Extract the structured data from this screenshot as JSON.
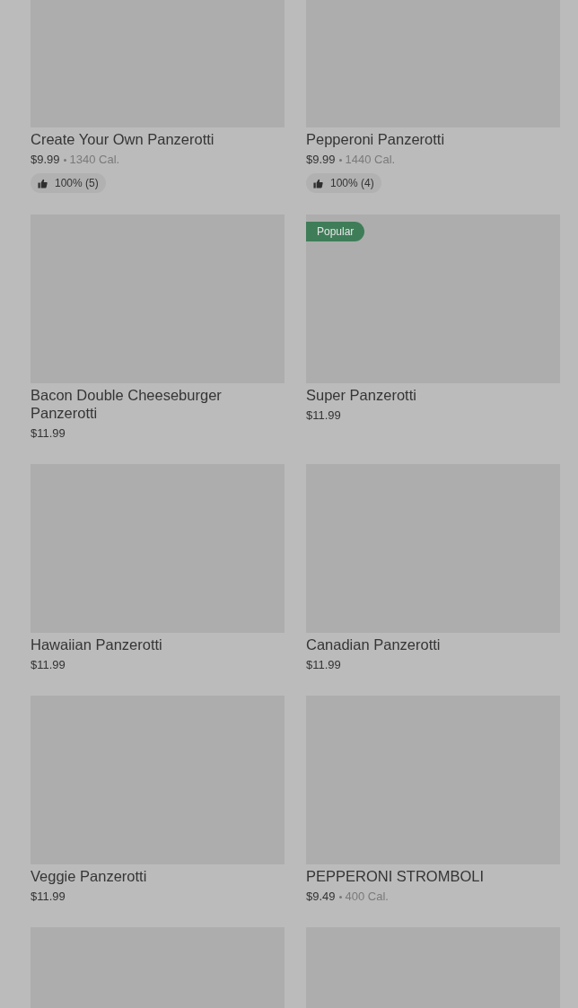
{
  "menu_rows": [
    {
      "items": [
        {
          "kind": "full",
          "name": "Create Your Own Panzerotti",
          "price": "$9.99",
          "calories": "1340 Cal.",
          "rating": "100% (5)"
        },
        {
          "kind": "full",
          "name": "Pepperoni Panzerotti",
          "price": "$9.99",
          "calories": "1440 Cal.",
          "rating": "100% (4)"
        }
      ]
    },
    {
      "items": [
        {
          "kind": "full",
          "name": "Bacon Double Cheeseburger Panzerotti",
          "price": "$11.99"
        },
        {
          "kind": "full",
          "name": "Super Panzerotti",
          "price": "$11.99",
          "badge": "Popular"
        }
      ]
    },
    {
      "items": [
        {
          "kind": "full",
          "name": "Hawaiian Panzerotti",
          "price": "$11.99"
        },
        {
          "kind": "full",
          "name": "Canadian Panzerotti",
          "price": "$11.99"
        }
      ]
    },
    {
      "items": [
        {
          "kind": "full",
          "name": "Veggie Panzerotti",
          "price": "$11.99"
        },
        {
          "kind": "full",
          "name": "PEPPERONI STROMBOLI",
          "price": "$9.49",
          "calories": "400 Cal."
        }
      ]
    },
    {
      "items": [
        {
          "kind": "image_only"
        },
        {
          "kind": "image_only"
        }
      ]
    }
  ]
}
